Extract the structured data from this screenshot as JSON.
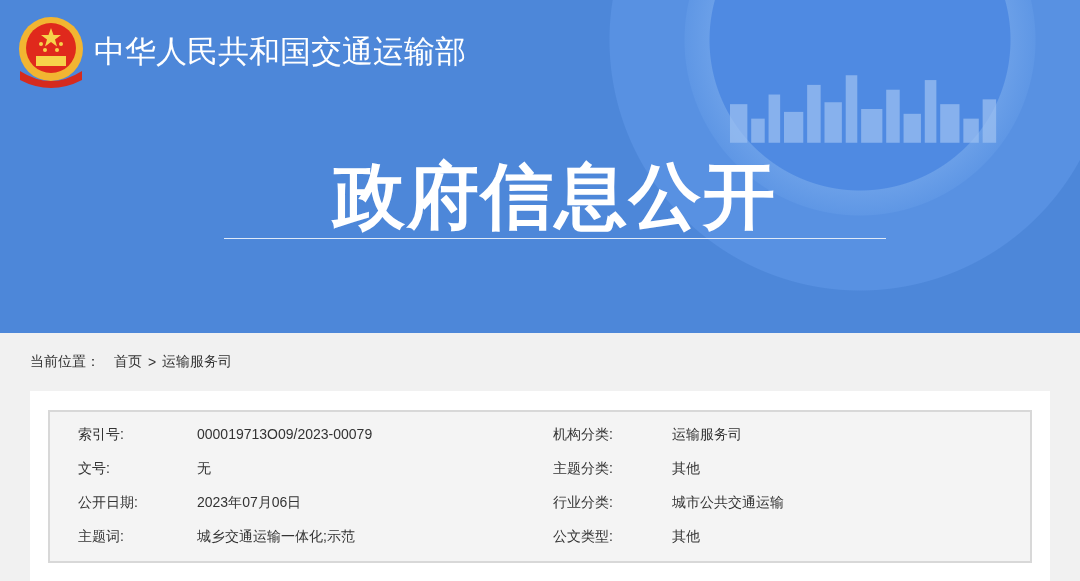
{
  "header": {
    "site_name": "中华人民共和国交通运输部",
    "page_title": "政府信息公开"
  },
  "breadcrumb": {
    "label": "当前位置：",
    "separator": ">",
    "items": [
      "首页",
      "运输服务司"
    ]
  },
  "info_table": {
    "rows": [
      {
        "label": "索引号:",
        "value": "000019713O09/2023-00079",
        "label_2": "机构分类:",
        "value_2": "运输服务司"
      },
      {
        "label": "文号:",
        "value": "无",
        "label_2": "主题分类:",
        "value_2": "其他"
      },
      {
        "label": "公开日期:",
        "value": "2023年07月06日",
        "label_2": "行业分类:",
        "value_2": "城市公共交通运输"
      },
      {
        "label": "主题词:",
        "value": "城乡交通运输一体化;示范",
        "label_2": "公文类型:",
        "value_2": "其他"
      }
    ]
  }
}
